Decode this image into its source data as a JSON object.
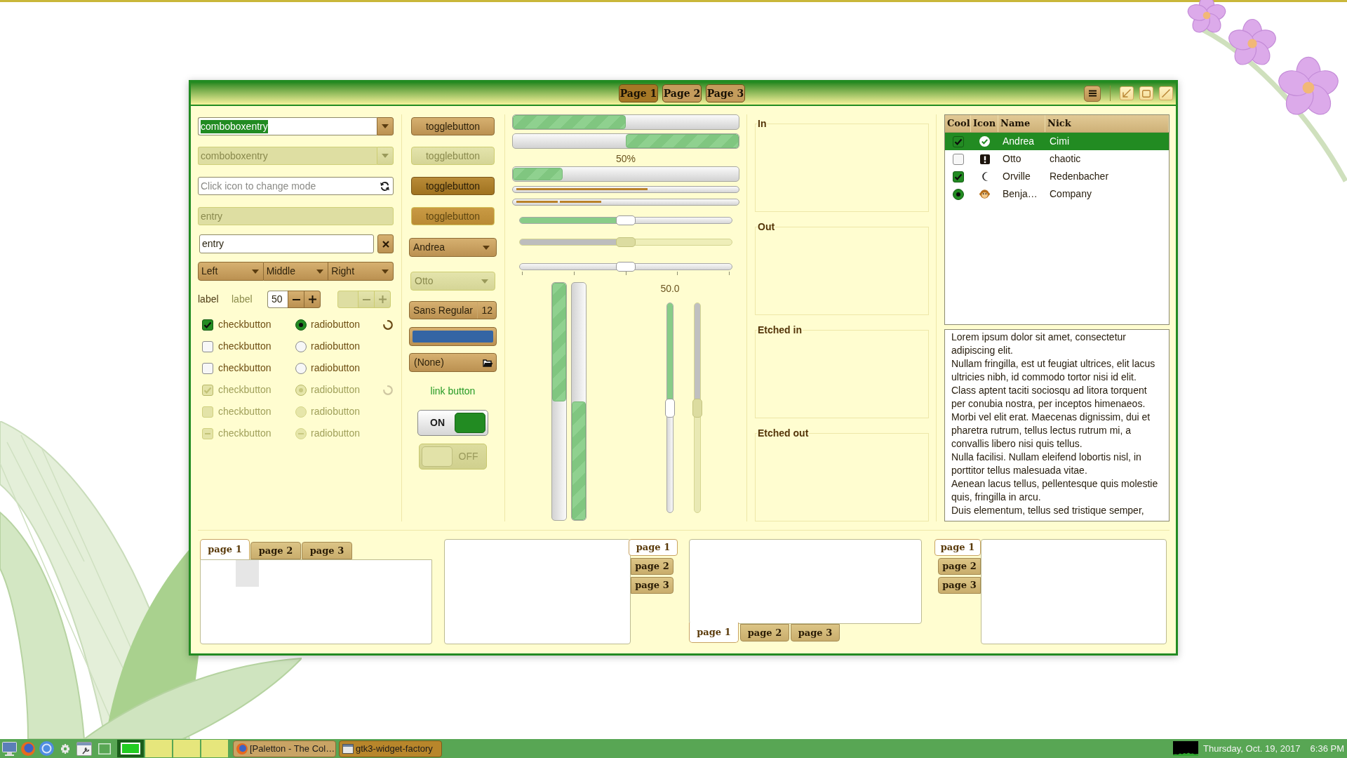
{
  "header_bar": {
    "stack_pages": [
      {
        "label": "Page 1",
        "selected": true
      },
      {
        "label": "Page 2",
        "selected": false
      },
      {
        "label": "Page 3",
        "selected": false
      }
    ]
  },
  "entries": [
    {
      "kind": "combo",
      "value": "comboboxentry",
      "text_selected": true,
      "disabled": false
    },
    {
      "kind": "combo",
      "value": "comboboxentry",
      "text_selected": false,
      "disabled": true
    },
    {
      "kind": "mode",
      "placeholder": "Click icon to change mode",
      "disabled": false
    },
    {
      "kind": "plain",
      "value": "entry",
      "disabled": true
    },
    {
      "kind": "clear",
      "value": "entry",
      "disabled": false
    }
  ],
  "linked_combos": [
    {
      "label": "Left"
    },
    {
      "label": "Middle"
    },
    {
      "label": "Right"
    }
  ],
  "labels": [
    {
      "text": "label",
      "disabled": false
    },
    {
      "text": "label",
      "disabled": true
    }
  ],
  "spin_buttons": [
    {
      "value": "50",
      "disabled": false
    },
    {
      "disabled": true
    }
  ],
  "check_rows": [
    {
      "check": {
        "label": "checkbutton",
        "checked": true,
        "inconsistent": false,
        "disabled": false
      },
      "radio": {
        "label": "radiobutton",
        "selected": true,
        "inconsistent": false,
        "disabled": false
      },
      "spinner": {
        "disabled": false
      }
    },
    {
      "check": {
        "label": "checkbutton",
        "checked": false,
        "inconsistent": false,
        "disabled": false
      },
      "radio": {
        "label": "radiobutton",
        "selected": false,
        "inconsistent": false,
        "disabled": false
      }
    },
    {
      "check": {
        "label": "checkbutton",
        "checked": false,
        "inconsistent": false,
        "disabled": false
      },
      "radio": {
        "label": "radiobutton",
        "selected": false,
        "inconsistent": false,
        "disabled": false
      }
    },
    {
      "check": {
        "label": "checkbutton",
        "checked": true,
        "inconsistent": false,
        "disabled": true
      },
      "radio": {
        "label": "radiobutton",
        "selected": true,
        "inconsistent": false,
        "disabled": true
      },
      "spinner": {
        "disabled": true
      }
    },
    {
      "check": {
        "label": "checkbutton",
        "checked": false,
        "inconsistent": false,
        "disabled": true
      },
      "radio": {
        "label": "radiobutton",
        "selected": false,
        "inconsistent": false,
        "disabled": true
      }
    },
    {
      "check": {
        "label": "checkbutton",
        "checked": false,
        "inconsistent": true,
        "disabled": true
      },
      "radio": {
        "label": "radiobutton",
        "selected": false,
        "inconsistent": true,
        "disabled": true
      }
    }
  ],
  "toggle_buttons": [
    {
      "label": "togglebutton",
      "active": false,
      "disabled": false
    },
    {
      "label": "togglebutton",
      "active": false,
      "disabled": true
    },
    {
      "label": "togglebutton",
      "active": true,
      "disabled": false
    },
    {
      "label": "togglebutton",
      "active": true,
      "disabled": true
    }
  ],
  "combo_boxes": [
    {
      "value": "Andrea",
      "disabled": false
    },
    {
      "value": "Otto",
      "disabled": true
    }
  ],
  "font_button": {
    "font": "Sans Regular",
    "size": "12"
  },
  "color_button": {
    "color": "#3465a4"
  },
  "file_button": {
    "label": "(None)"
  },
  "link_button": {
    "label": "link button"
  },
  "switches": [
    {
      "label": "ON",
      "on": true,
      "disabled": false
    },
    {
      "label": "OFF",
      "on": false,
      "disabled": true
    }
  ],
  "progress_bars": [
    {
      "kind": "normal",
      "level": 0.5,
      "inverted": false
    },
    {
      "kind": "normal",
      "level": 0.5,
      "inverted": true
    },
    {
      "kind": "pulse",
      "level": 0.22,
      "text": "50%"
    }
  ],
  "level_bars": [
    {
      "kind": "continuous",
      "level": 0.6
    },
    {
      "kind": "discrete",
      "level": 0.4
    }
  ],
  "scales": [
    {
      "level": 0.5,
      "origin": true,
      "marks": false,
      "disabled": false
    },
    {
      "level": 0.5,
      "origin": true,
      "marks": false,
      "disabled": true
    },
    {
      "level": 0.5,
      "origin": false,
      "marks": true,
      "disabled": false
    }
  ],
  "vertical_progress_bars": [
    {
      "level": 0.5,
      "inverted": false
    },
    {
      "level": 0.5,
      "inverted": true
    }
  ],
  "vertical_scales": [
    {
      "level": 0.5,
      "value_text": "50.0",
      "disabled": false
    },
    {
      "level": 0.5,
      "disabled": true
    }
  ],
  "frames": [
    {
      "label": "In"
    },
    {
      "label": "Out"
    },
    {
      "label": "Etched in"
    },
    {
      "label": "Etched out"
    }
  ],
  "tree": {
    "columns": [
      "Cool",
      "Icon",
      "Name",
      "Nick"
    ],
    "rows": [
      {
        "cool": {
          "kind": "check",
          "checked": true
        },
        "name": "Andrea",
        "nick": "Cimi",
        "selected": true
      },
      {
        "cool": {
          "kind": "check",
          "checked": false
        },
        "name": "Otto",
        "nick": "chaotic",
        "selected": false
      },
      {
        "cool": {
          "kind": "check",
          "checked": true
        },
        "name": "Orville",
        "nick": "Redenbacher",
        "selected": false
      },
      {
        "cool": {
          "kind": "radio",
          "checked": true
        },
        "name": "Benja…",
        "nick": "Company",
        "selected": false
      }
    ]
  },
  "text_view": {
    "paragraphs": [
      "Lorem ipsum dolor sit amet, consectetur adipiscing elit.",
      "Nullam fringilla, est ut feugiat ultrices, elit lacus ultricies nibh, id commodo tortor nisi id elit.",
      "Class aptent taciti sociosqu ad litora torquent per conubia nostra, per inceptos himenaeos.",
      "Morbi vel elit erat. Maecenas dignissim, dui et pharetra rutrum, tellus lectus rutrum mi, a convallis libero nisi quis tellus.",
      "Nulla facilisi. Nullam eleifend lobortis nisl, in porttitor tellus malesuada vitae.",
      "Aenean lacus tellus, pellentesque quis molestie quis, fringilla in arcu.",
      "Duis elementum, tellus sed tristique semper,"
    ]
  },
  "notebooks": [
    {
      "kind": "top",
      "tabs": [
        {
          "label": "page 1",
          "selected": true
        },
        {
          "label": "page 2",
          "selected": false
        },
        {
          "label": "page 3",
          "selected": false
        }
      ]
    },
    {
      "kind": "right",
      "tabs": [
        {
          "label": "page 1",
          "selected": true
        },
        {
          "label": "page 2",
          "selected": false
        },
        {
          "label": "page 3",
          "selected": false
        }
      ]
    },
    {
      "kind": "bottom",
      "tabs": [
        {
          "label": "page 1",
          "selected": true
        },
        {
          "label": "page 2",
          "selected": false
        },
        {
          "label": "page 3",
          "selected": false
        }
      ]
    },
    {
      "kind": "left",
      "tabs": [
        {
          "label": "page 1",
          "selected": true
        },
        {
          "label": "page 2",
          "selected": false
        },
        {
          "label": "page 3",
          "selected": false
        }
      ]
    }
  ],
  "taskbar": {
    "workspaces": [
      {
        "selected": true
      },
      {
        "selected": false
      },
      {
        "selected": false
      },
      {
        "selected": false
      }
    ],
    "tasks": [
      {
        "kind": "browser",
        "label": "[Paletton - The Col…",
        "selected": false
      },
      {
        "kind": "window",
        "label": "gtk3-widget-factory",
        "selected": true
      }
    ],
    "date": "Thursday, Oct. 19, 2017",
    "time": "6:36 PM"
  }
}
